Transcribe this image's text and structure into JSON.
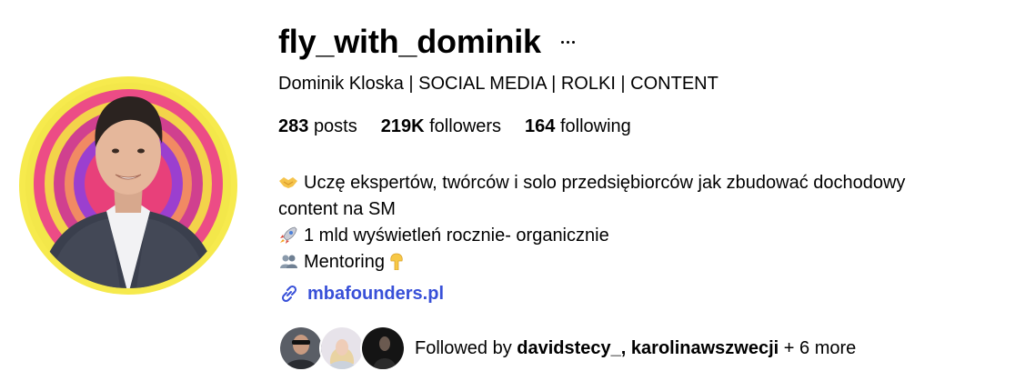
{
  "profile": {
    "username": "fly_with_dominik",
    "full_name": "Dominik Kloska | SOCIAL MEDIA | ROLKI | CONTENT",
    "stats": {
      "posts_count": "283",
      "posts_label": "posts",
      "followers_count": "219K",
      "followers_label": "followers",
      "following_count": "164",
      "following_label": "following"
    },
    "bio": {
      "line1": "Uczę ekspertów, twórców i solo przedsiębiorców jak zbudować dochodowy",
      "line2": "content na SM",
      "line3": "1 mld wyświetleń rocznie- organicznie",
      "line4": "Mentoring",
      "emojis": [
        "handshake-emoji",
        "rocket-emoji",
        "busts-emoji",
        "pointing-down-emoji"
      ]
    },
    "link": "mbafounders.pl",
    "followed_by": {
      "prefix": "Followed by",
      "user1": "davidstecy_",
      "separator": ",",
      "user2": "karolinawszwecji",
      "suffix": "+ 6 more"
    }
  },
  "colors": {
    "link": "#3850d8",
    "avatar_ring_outer": "#f5e84a",
    "avatar_ring_pink": "#e8407a",
    "avatar_ring_purple": "#8a3fd1"
  },
  "icons": {
    "more": "more-horizontal-icon",
    "link": "link-chain-icon"
  }
}
